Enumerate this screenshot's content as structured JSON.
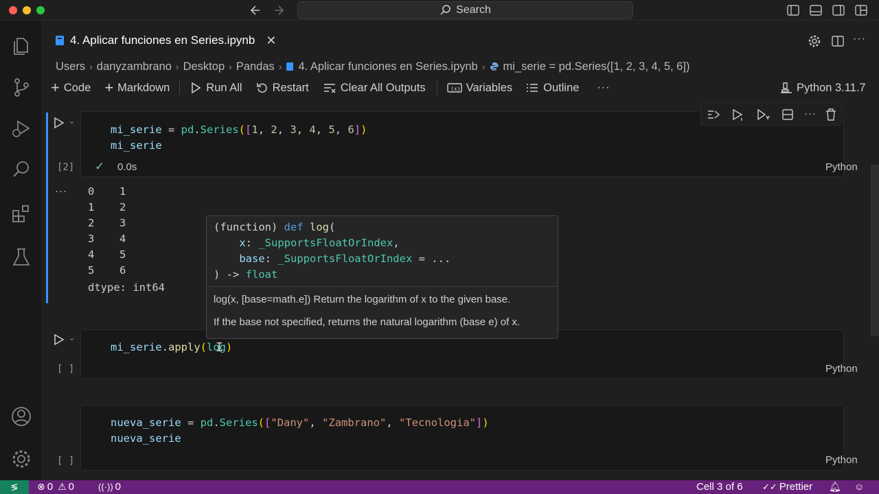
{
  "titlebar": {
    "search_label": "Search"
  },
  "tab": {
    "label": "4. Aplicar funciones en Series.ipynb"
  },
  "breadcrumb": [
    "Users",
    "danyzambrano",
    "Desktop",
    "Pandas",
    "4. Aplicar funciones en Series.ipynb",
    "mi_serie = pd.Series([1, 2, 3, 4, 5, 6])"
  ],
  "toolbar": {
    "code": "Code",
    "markdown": "Markdown",
    "run_all": "Run All",
    "restart": "Restart",
    "clear_outputs": "Clear All Outputs",
    "variables": "Variables",
    "outline": "Outline",
    "more": "···",
    "kernel": "Python 3.11.7"
  },
  "cells": [
    {
      "exec_count": "[2]",
      "time": "0.0s",
      "language": "Python"
    },
    {
      "exec_count": "[ ]",
      "language": "Python"
    },
    {
      "exec_count": "[ ]",
      "language": "Python"
    }
  ],
  "output": {
    "ellipsis": "···",
    "rows": [
      [
        "0",
        "1"
      ],
      [
        "1",
        "2"
      ],
      [
        "2",
        "3"
      ],
      [
        "3",
        "4"
      ],
      [
        "4",
        "5"
      ],
      [
        "5",
        "6"
      ]
    ],
    "dtype": "dtype: int64"
  },
  "hover": {
    "doc1": "log(x, [base=math.e]) Return the logarithm of x to the given base.",
    "doc2": "If the base not specified, returns the natural logarithm (base e) of x."
  },
  "statusbar": {
    "errors": "0",
    "warnings": "0",
    "ports": "0",
    "cell": "Cell 3 of 6",
    "prettier": "Prettier"
  },
  "colors": {
    "accent": "#3794ff",
    "statusbar": "#68217a"
  }
}
